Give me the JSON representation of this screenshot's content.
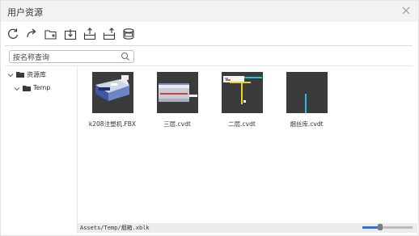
{
  "window": {
    "title": "用户资源",
    "close_icon": "close-icon"
  },
  "toolbar": {
    "buttons": [
      {
        "name": "refresh",
        "icon": "refresh-icon"
      },
      {
        "name": "redo",
        "icon": "redo-icon"
      },
      {
        "name": "new-folder",
        "icon": "new-folder-icon"
      },
      {
        "name": "import",
        "icon": "import-icon"
      },
      {
        "name": "export",
        "icon": "export-icon"
      },
      {
        "name": "upload",
        "icon": "upload-icon"
      },
      {
        "name": "database",
        "icon": "database-icon"
      }
    ]
  },
  "search": {
    "placeholder": "按名称查询",
    "icon": "search-icon"
  },
  "tree": {
    "items": [
      {
        "label": "资源库",
        "expanded": true
      },
      {
        "label": "Temp",
        "expanded": true
      }
    ]
  },
  "files": [
    {
      "name": "k208注塑机.FBX"
    },
    {
      "name": "三层.cvdt"
    },
    {
      "name": "二层.cvdt"
    },
    {
      "name": "烟丝库.cvdt"
    }
  ],
  "status": {
    "path": "Assets/Temp/烟箱.xblk"
  },
  "zoom": {
    "level": 0.35
  },
  "colors": {
    "accent": "#2f72d8",
    "thumb_bg": "#3b3b3b",
    "yellow": "#e3d52c",
    "cyan": "#21c3d6"
  }
}
